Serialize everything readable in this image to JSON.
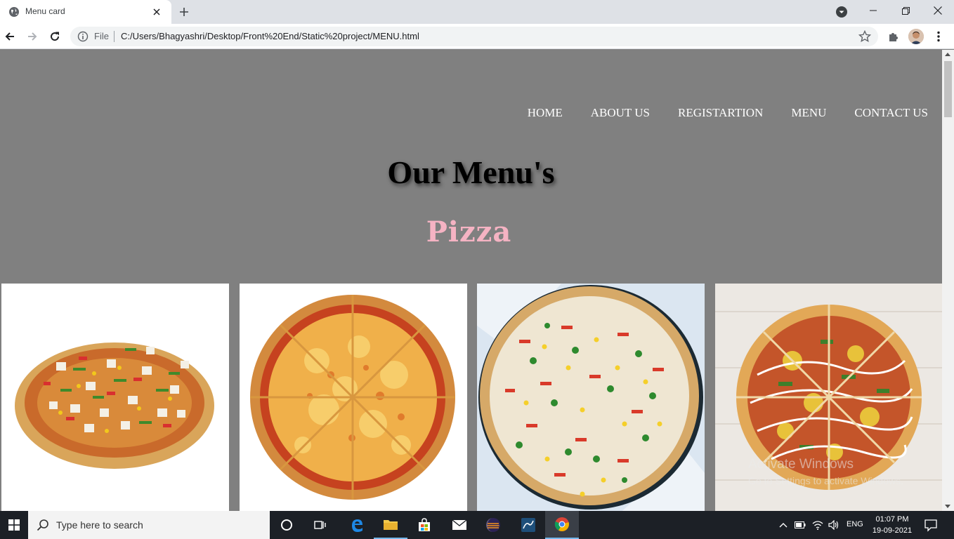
{
  "browser": {
    "tab_title": "Menu card",
    "file_label": "File",
    "url": "C:/Users/Bhagyashri/Desktop/Front%20End/Static%20project/MENU.html"
  },
  "nav": {
    "items": [
      "HOME",
      "ABOUT US",
      "REGISTARTION",
      "MENU",
      "CONTACT US"
    ]
  },
  "page": {
    "heading": "Our Menu's",
    "section_title": "Pizza"
  },
  "menu_items": [
    {
      "image": "paneer-veggie-pizza"
    },
    {
      "image": "cheese-margherita-pizza"
    },
    {
      "image": "corn-capsicum-pizza"
    },
    {
      "image": "veggie-mayo-drizzle-pizza"
    }
  ],
  "watermark": {
    "title": "Activate Windows",
    "subtitle": "Go to Settings to activate Windows."
  },
  "taskbar": {
    "search_placeholder": "Type here to search",
    "language": "ENG",
    "time": "01:07 PM",
    "date": "19-09-2021"
  },
  "colors": {
    "page_background": "#808080",
    "nav_text": "#ffffff",
    "section_title": "#f5b3c3"
  }
}
